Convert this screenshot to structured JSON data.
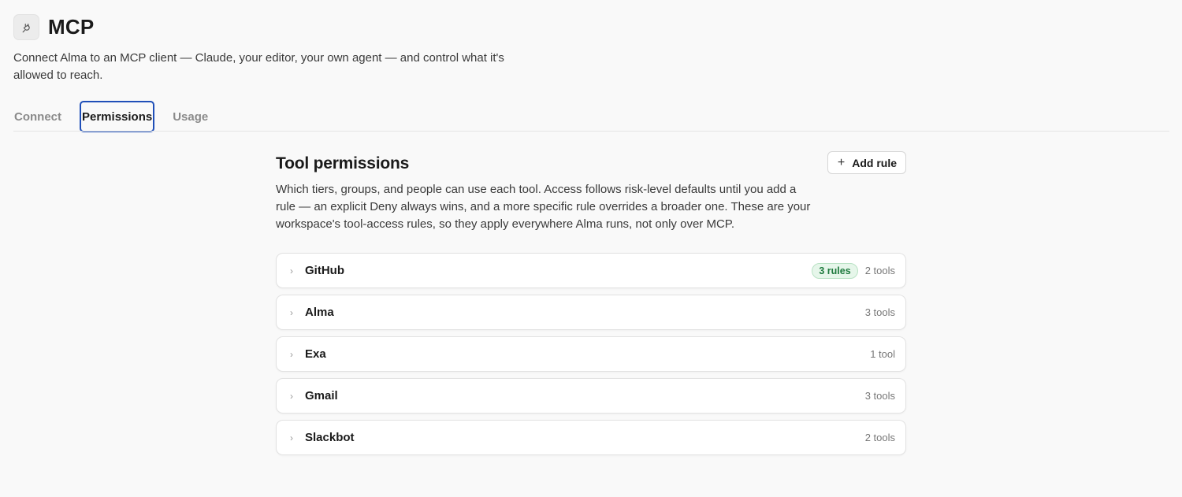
{
  "header": {
    "icon": "plug-icon",
    "title": "MCP",
    "subtitle": "Connect Alma to an MCP client — Claude, your editor, your own agent — and control what it's allowed to reach."
  },
  "tabs": [
    {
      "label": "Connect",
      "active": false
    },
    {
      "label": "Permissions",
      "active": true
    },
    {
      "label": "Usage",
      "active": false
    }
  ],
  "permissions": {
    "title": "Tool permissions",
    "add_rule_label": "Add rule",
    "description": "Which tiers, groups, and people can use each tool. Access follows risk-level defaults until you add a rule — an explicit Deny always wins, and a more specific rule overrides a broader one. These are your workspace's tool-access rules, so they apply everywhere Alma runs, not only over MCP.",
    "tools": [
      {
        "name": "GitHub",
        "badge": "3 rules",
        "count": "2 tools"
      },
      {
        "name": "Alma",
        "badge": null,
        "count": "3 tools"
      },
      {
        "name": "Exa",
        "badge": null,
        "count": "1 tool"
      },
      {
        "name": "Gmail",
        "badge": null,
        "count": "3 tools"
      },
      {
        "name": "Slackbot",
        "badge": null,
        "count": "2 tools"
      }
    ]
  },
  "colors": {
    "accent_focus": "#1f4fb8",
    "badge_text": "#1f7a3e",
    "badge_bg": "#e6f6ea"
  }
}
